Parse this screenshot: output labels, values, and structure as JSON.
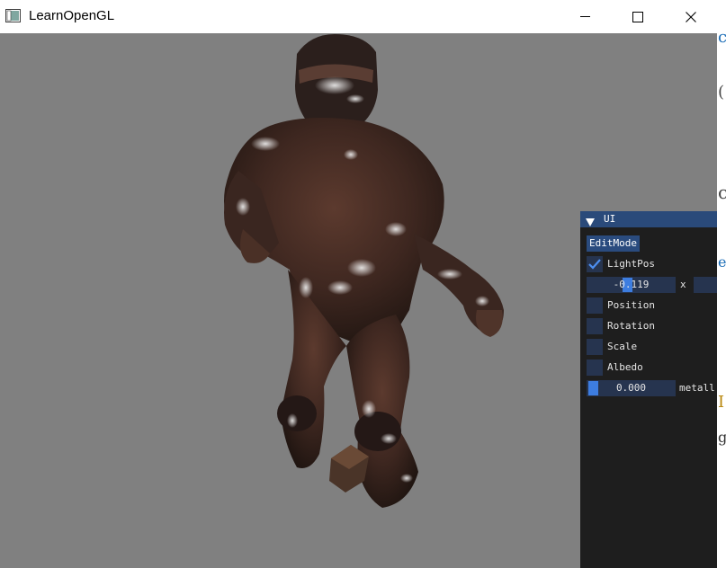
{
  "window": {
    "title": "LearnOpenGL",
    "icon": "window-app-icon",
    "controls": [
      "minimize-icon",
      "maximize-icon",
      "close-icon"
    ]
  },
  "viewport": {
    "background_color": "#808080",
    "content": "3d-rendered-character-model"
  },
  "ui_panel": {
    "title": "UI",
    "collapse_icon": "triangle-down-icon",
    "edit_mode_label": "EditMode",
    "light_pos": {
      "label": "LightPos",
      "checked": true,
      "x_value": "-0.119",
      "axis_label": "x"
    },
    "checkboxes": [
      {
        "label": "Position",
        "checked": false
      },
      {
        "label": "Rotation",
        "checked": false
      },
      {
        "label": "Scale",
        "checked": false
      },
      {
        "label": "Albedo",
        "checked": false
      }
    ],
    "metallic": {
      "value": "0.000",
      "label": "metall"
    },
    "colors": {
      "header": "#2a4a7a",
      "button": "#2a4b7e",
      "frame": "#26344f",
      "grab": "#3d7de0",
      "panel_bg": "#1e1e1e"
    }
  }
}
